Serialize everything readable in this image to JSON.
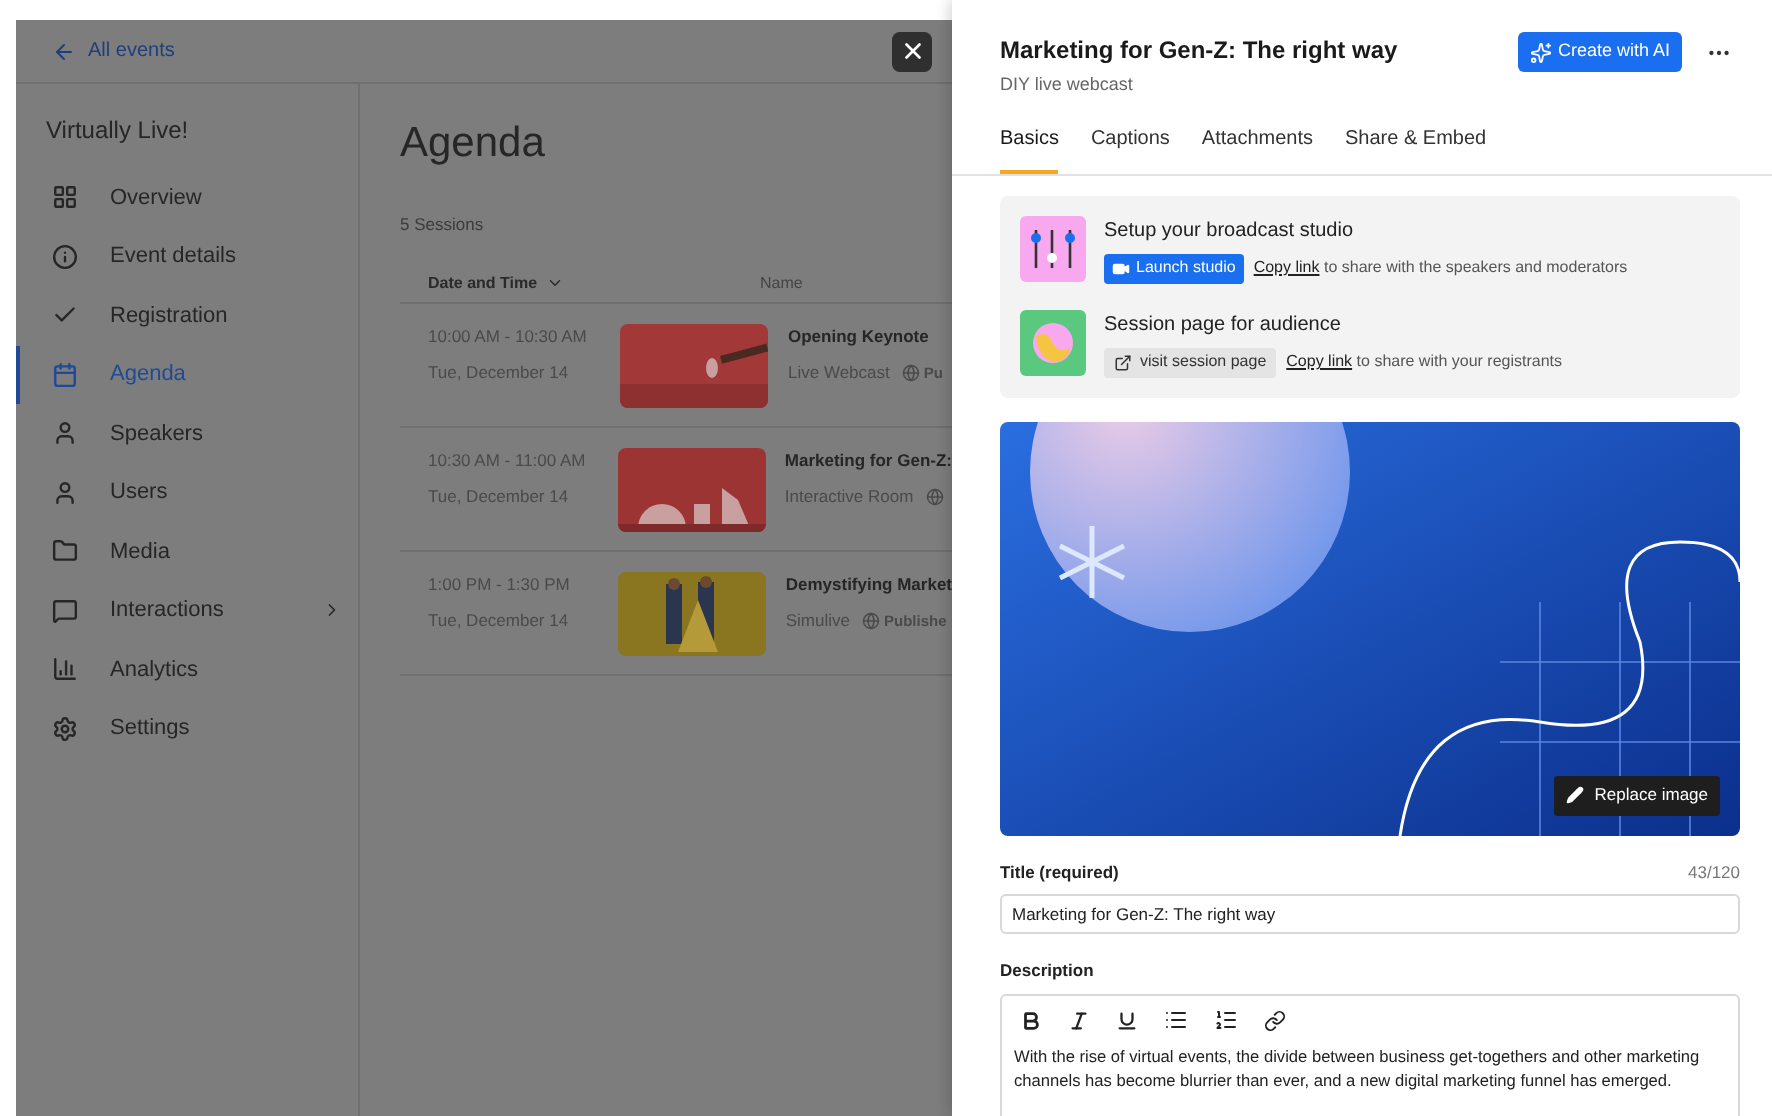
{
  "background": {
    "back_link": "All events",
    "event_name": "Virtually Live!",
    "nav": [
      {
        "label": "Overview",
        "selected": false,
        "expandable": false
      },
      {
        "label": "Event details",
        "selected": false,
        "expandable": false
      },
      {
        "label": "Registration",
        "selected": false,
        "expandable": false
      },
      {
        "label": "Agenda",
        "selected": true,
        "expandable": false
      },
      {
        "label": "Speakers",
        "selected": false,
        "expandable": false
      },
      {
        "label": "Users",
        "selected": false,
        "expandable": false
      },
      {
        "label": "Media",
        "selected": false,
        "expandable": false
      },
      {
        "label": "Interactions",
        "selected": false,
        "expandable": true
      },
      {
        "label": "Analytics",
        "selected": false,
        "expandable": false
      },
      {
        "label": "Settings",
        "selected": false,
        "expandable": false
      }
    ],
    "page_title": "Agenda",
    "count": "5 Sessions",
    "columns": [
      "Date and Time",
      "Name"
    ],
    "sessions": [
      {
        "time": "10:00 AM - 10:30 AM",
        "date": "Tue, December 14",
        "name": "Opening Keynote",
        "type": "Live Webcast",
        "status": "Pu"
      },
      {
        "time": "10:30 AM - 11:00 AM",
        "date": "Tue, December 14",
        "name": "Marketing for Gen-Z:",
        "type": "Interactive Room"
      },
      {
        "time": "1:00 PM - 1:30 PM",
        "date": "Tue, December 14",
        "name": "Demystifying Market",
        "type": "Simulive",
        "status": "Publishe"
      }
    ]
  },
  "panel": {
    "title": "Marketing for Gen-Z: The right way",
    "subtitle": "DIY live webcast",
    "ai_button": "Create with AI",
    "tabs": [
      {
        "label": "Basics",
        "selected": true
      },
      {
        "label": "Captions",
        "selected": false
      },
      {
        "label": "Attachments",
        "selected": false
      },
      {
        "label": "Share & Embed",
        "selected": false
      }
    ],
    "setup": [
      {
        "kind": "studio",
        "heading": "Setup your broadcast studio",
        "action": "Launch studio",
        "link": "Copy link",
        "hint": "to share with the speakers and moderators"
      },
      {
        "kind": "audience",
        "heading": "Session page for audience",
        "action": "visit session page",
        "link": "Copy link",
        "hint": "to share with your registrants"
      }
    ],
    "replace_image": "Replace image",
    "title_label": "Title (required)",
    "title_count": "43/120",
    "title_value": "Marketing for Gen-Z: The right way",
    "description_label": "Description",
    "description": "With the rise of virtual events, the divide between business get-togethers and other marketing channels has become blurrier than ever, and a new digital marketing funnel has emerged."
  }
}
